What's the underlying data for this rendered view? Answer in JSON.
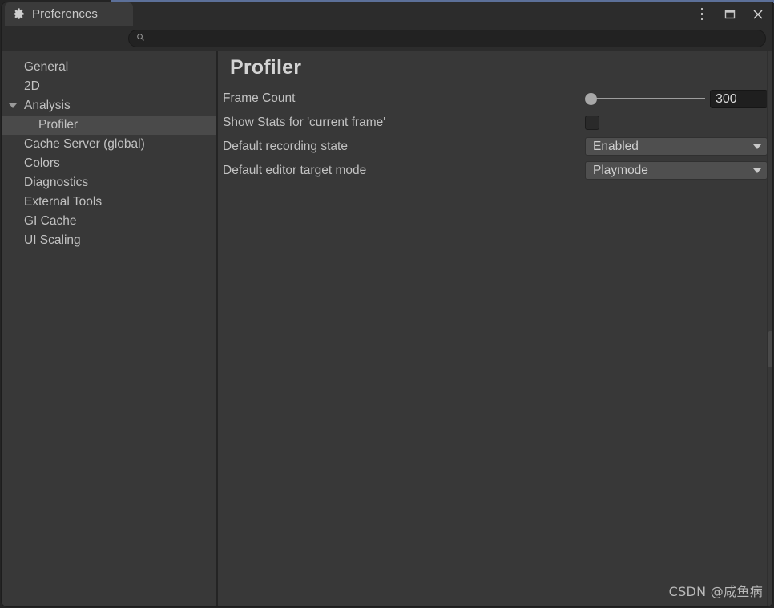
{
  "window": {
    "tab_title": "Preferences",
    "gear_icon": "gear-icon",
    "controls": {
      "menu_icon": "kebab-menu-icon",
      "maximize_icon": "maximize-icon",
      "close_icon": "close-icon"
    },
    "accent_color": "#5c7099"
  },
  "search": {
    "value": "",
    "placeholder": "",
    "icon": "search-icon"
  },
  "sidebar": {
    "items": [
      {
        "label": "General",
        "level": 0,
        "selected": false,
        "caret": false
      },
      {
        "label": "2D",
        "level": 0,
        "selected": false,
        "caret": false
      },
      {
        "label": "Analysis",
        "level": 0,
        "selected": false,
        "caret": true
      },
      {
        "label": "Profiler",
        "level": 1,
        "selected": true,
        "caret": false
      },
      {
        "label": "Cache Server (global)",
        "level": 0,
        "selected": false,
        "caret": false
      },
      {
        "label": "Colors",
        "level": 0,
        "selected": false,
        "caret": false
      },
      {
        "label": "Diagnostics",
        "level": 0,
        "selected": false,
        "caret": false
      },
      {
        "label": "External Tools",
        "level": 0,
        "selected": false,
        "caret": false
      },
      {
        "label": "GI Cache",
        "level": 0,
        "selected": false,
        "caret": false
      },
      {
        "label": "UI Scaling",
        "level": 0,
        "selected": false,
        "caret": false
      }
    ]
  },
  "content": {
    "title": "Profiler",
    "rows": [
      {
        "label": "Frame Count",
        "control": "slider",
        "value": "300",
        "slider_position_pct": 0
      },
      {
        "label": "Show Stats for 'current frame'",
        "control": "checkbox",
        "checked": false
      },
      {
        "label": "Default recording state",
        "control": "dropdown",
        "value": "Enabled",
        "arrow_icon": "chevron-down-icon"
      },
      {
        "label": "Default editor target mode",
        "control": "dropdown",
        "value": "Playmode",
        "arrow_icon": "chevron-down-icon"
      }
    ]
  },
  "watermark": {
    "text": "CSDN @咸鱼病"
  }
}
